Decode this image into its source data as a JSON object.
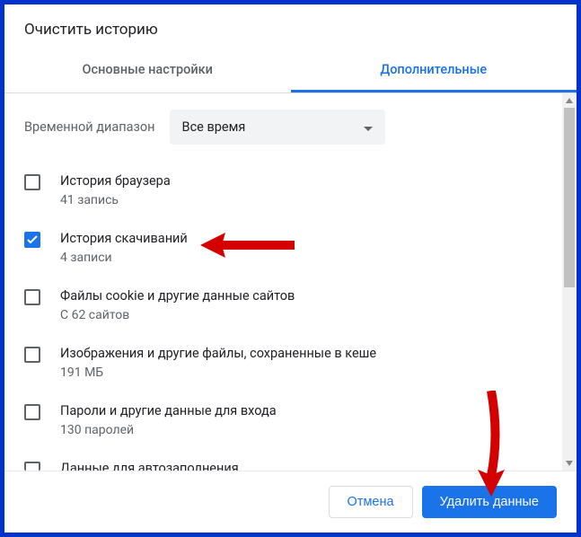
{
  "dialog": {
    "title": "Очистить историю",
    "tabs": {
      "basic": "Основные настройки",
      "advanced": "Дополнительные",
      "active": "advanced"
    },
    "range": {
      "label": "Временной диапазон",
      "value": "Все время"
    },
    "options": [
      {
        "title": "История браузера",
        "sub": "41 запись",
        "checked": false
      },
      {
        "title": "История скачиваний",
        "sub": "4 записи",
        "checked": true
      },
      {
        "title": "Файлы cookie и другие данные сайтов",
        "sub": "С 62 сайтов",
        "checked": false
      },
      {
        "title": "Изображения и другие файлы, сохраненные в кеше",
        "sub": "191 МБ",
        "checked": false
      },
      {
        "title": "Пароли и другие данные для входа",
        "sub": "130 паролей",
        "checked": false
      },
      {
        "title": "Данные для автозаполнения",
        "sub": "",
        "checked": false
      }
    ],
    "buttons": {
      "cancel": "Отмена",
      "clear": "Удалить данные"
    }
  },
  "annotations": {
    "arrow_color": "#d40000"
  }
}
